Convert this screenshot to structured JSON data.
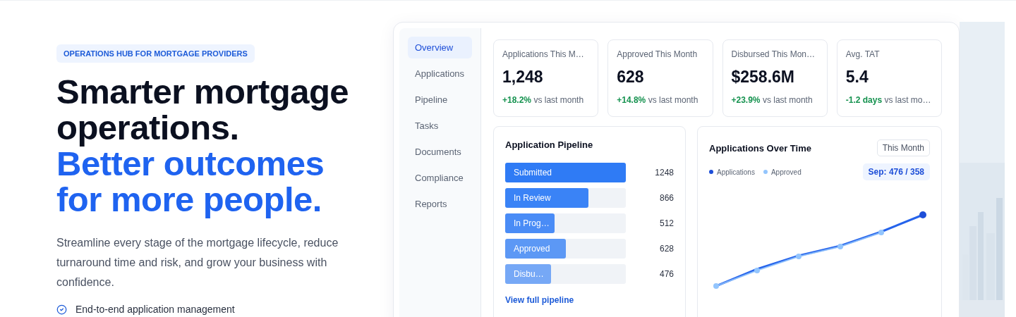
{
  "badge": "OPERATIONS HUB FOR MORTGAGE PROVIDERS",
  "headline": {
    "dark": [
      "Smarter mortgage",
      "operations."
    ],
    "accent": [
      "Better outcomes",
      "for more people."
    ]
  },
  "intro": "Streamline every stage of the mortgage lifecycle, reduce turnaround time and risk, and grow your business with confidence.",
  "features": [
    {
      "text": "End-to-end application management"
    }
  ],
  "dashboard": {
    "sidebar": [
      {
        "label": "Overview",
        "selected": true
      },
      {
        "label": "Applications",
        "selected": false
      },
      {
        "label": "Pipeline",
        "selected": false
      },
      {
        "label": "Tasks",
        "selected": false
      },
      {
        "label": "Documents",
        "selected": false
      },
      {
        "label": "Compliance",
        "selected": false
      },
      {
        "label": "Reports",
        "selected": false
      }
    ],
    "stats": [
      {
        "label": "Applications This M…",
        "value": "1,248",
        "change": "+18.2%",
        "note": "vs last month"
      },
      {
        "label": "Approved This Month",
        "value": "628",
        "change": "+14.8%",
        "note": "vs last month"
      },
      {
        "label": "Disbursed This Mon…",
        "value": "$258.6M",
        "change": "+23.9%",
        "note": "vs last month"
      },
      {
        "label": "Avg. TAT",
        "value": "5.4",
        "change": "-1.2 days",
        "note": "vs last mo…"
      }
    ],
    "pipeline": {
      "title": "Application Pipeline",
      "stages": [
        {
          "label": "Submitted",
          "count": "1248",
          "level": 1,
          "color": "#2f7bf5"
        },
        {
          "label": "In Review",
          "count": "866",
          "level": 0.69,
          "color": "#3a83f6"
        },
        {
          "label": "In Prog…",
          "count": "512",
          "level": 0.41,
          "color": "#4a8cf6"
        },
        {
          "label": "Approved",
          "count": "628",
          "level": 0.5,
          "color": "#5c98f5"
        },
        {
          "label": "Disbu…",
          "count": "476",
          "level": 0.38,
          "color": "#76a8f6"
        }
      ],
      "link": "View full pipeline"
    },
    "chart": {
      "title": "Applications Over Time",
      "period": "This Month",
      "legend": [
        {
          "label": "Applications",
          "color": "#1d4ed8"
        },
        {
          "label": "Approved",
          "color": "#93c5fd"
        }
      ],
      "tooltip": "Sep: 476 / 358"
    }
  }
}
